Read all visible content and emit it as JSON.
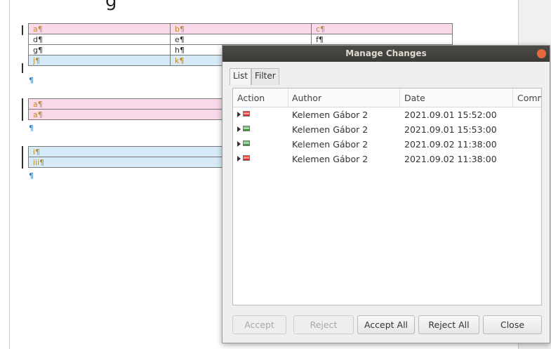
{
  "document": {
    "heading_crop": "g",
    "table1": [
      [
        {
          "text": "a¶",
          "style": "pink"
        },
        {
          "text": "b¶",
          "style": "pink"
        },
        {
          "text": "c¶",
          "style": "pink"
        }
      ],
      [
        {
          "text": "d¶",
          "style": "plain"
        },
        {
          "text": "e¶",
          "style": "plain"
        },
        {
          "text": "f¶",
          "style": "plain"
        }
      ],
      [
        {
          "text": "g¶",
          "style": "plain"
        },
        {
          "text": "h¶",
          "style": "plain"
        },
        {
          "text": "",
          "style": "plain"
        }
      ],
      [
        {
          "text": "j¶",
          "style": "blue"
        },
        {
          "text": "k¶",
          "style": "blue"
        },
        {
          "text": "",
          "style": "blue"
        }
      ]
    ],
    "table2": [
      [
        {
          "text": "a¶",
          "style": "pink"
        }
      ],
      [
        {
          "text": "a¶",
          "style": "pink"
        }
      ]
    ],
    "table3": [
      [
        {
          "text": "i¶",
          "style": "blue"
        }
      ],
      [
        {
          "text": "iii¶",
          "style": "blue"
        }
      ]
    ],
    "pilcrow": "¶"
  },
  "dialog": {
    "title": "Manage Changes",
    "tabs": [
      "List",
      "Filter"
    ],
    "columns": [
      "Action",
      "Author",
      "Date",
      "Comment"
    ],
    "rows": [
      {
        "action": "delete",
        "author": "Kelemen Gábor 2",
        "date": "2021.09.01 15:52:00",
        "comment": ""
      },
      {
        "action": "insert",
        "author": "Kelemen Gábor 2",
        "date": "2021.09.01 15:53:00",
        "comment": ""
      },
      {
        "action": "insert",
        "author": "Kelemen Gábor 2",
        "date": "2021.09.02 11:38:00",
        "comment": ""
      },
      {
        "action": "delete",
        "author": "Kelemen Gábor 2",
        "date": "2021.09.02 11:38:00",
        "comment": ""
      }
    ],
    "buttons": {
      "accept": "Accept",
      "reject": "Reject",
      "accept_all": "Accept All",
      "reject_all": "Reject All",
      "close": "Close"
    },
    "colors": {
      "titlebar": "#3c3b37",
      "close_dot": "#e8693c",
      "tracked_insert": "#d6ebf7",
      "tracked_delete": "#f9d9ea"
    }
  }
}
